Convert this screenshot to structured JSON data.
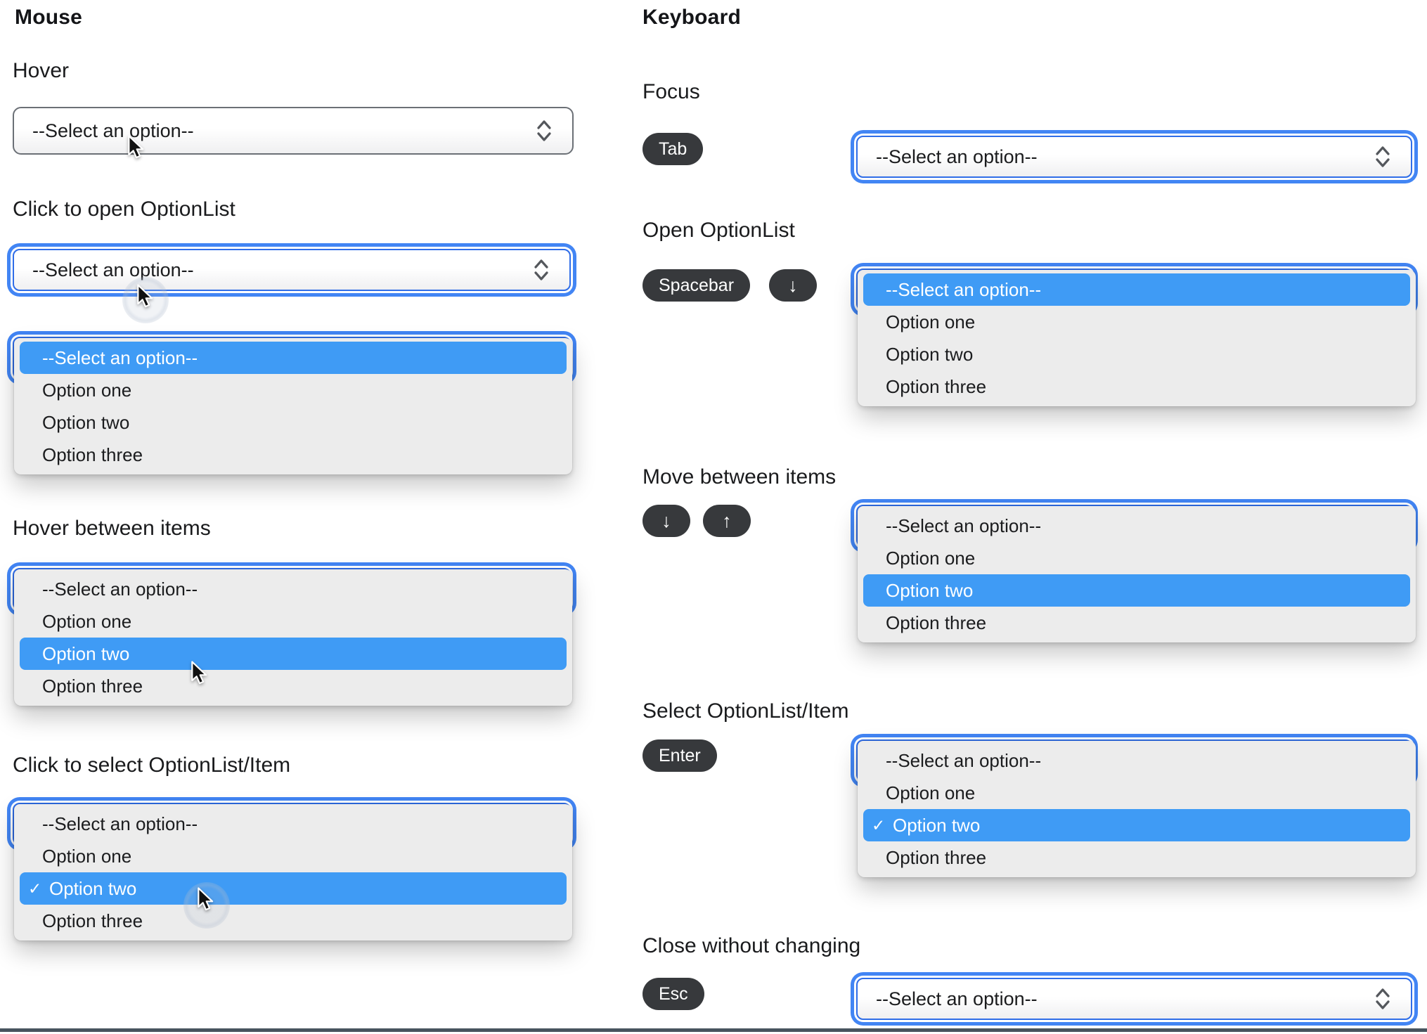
{
  "mouse": {
    "title": "Mouse",
    "hover_label": "Hover",
    "click_open_label": "Click to open OptionList",
    "hover_items_label": "Hover between items",
    "click_select_label": "Click to select OptionList/Item"
  },
  "keyboard": {
    "title": "Keyboard",
    "focus_label": "Focus",
    "open_label": "Open OptionList",
    "move_label": "Move between items",
    "select_label": "Select OptionList/Item",
    "close_label": "Close without changing"
  },
  "keys": {
    "tab": "Tab",
    "spacebar": "Spacebar",
    "enter": "Enter",
    "esc": "Esc",
    "arrow_down": "↓",
    "arrow_up": "↑"
  },
  "select": {
    "placeholder": "--Select an option--"
  },
  "options": [
    "--Select an option--",
    "Option one",
    "Option two",
    "Option three"
  ],
  "glyphs": {
    "check": "✓"
  },
  "colors": {
    "highlight_blue": "#3F9BF5",
    "focus_ring_blue": "#4285F4",
    "key_badge_bg": "#37393C",
    "panel_bg": "#ECECEC",
    "select_border": "#6B7076",
    "bottom_bar": "#47545E"
  }
}
